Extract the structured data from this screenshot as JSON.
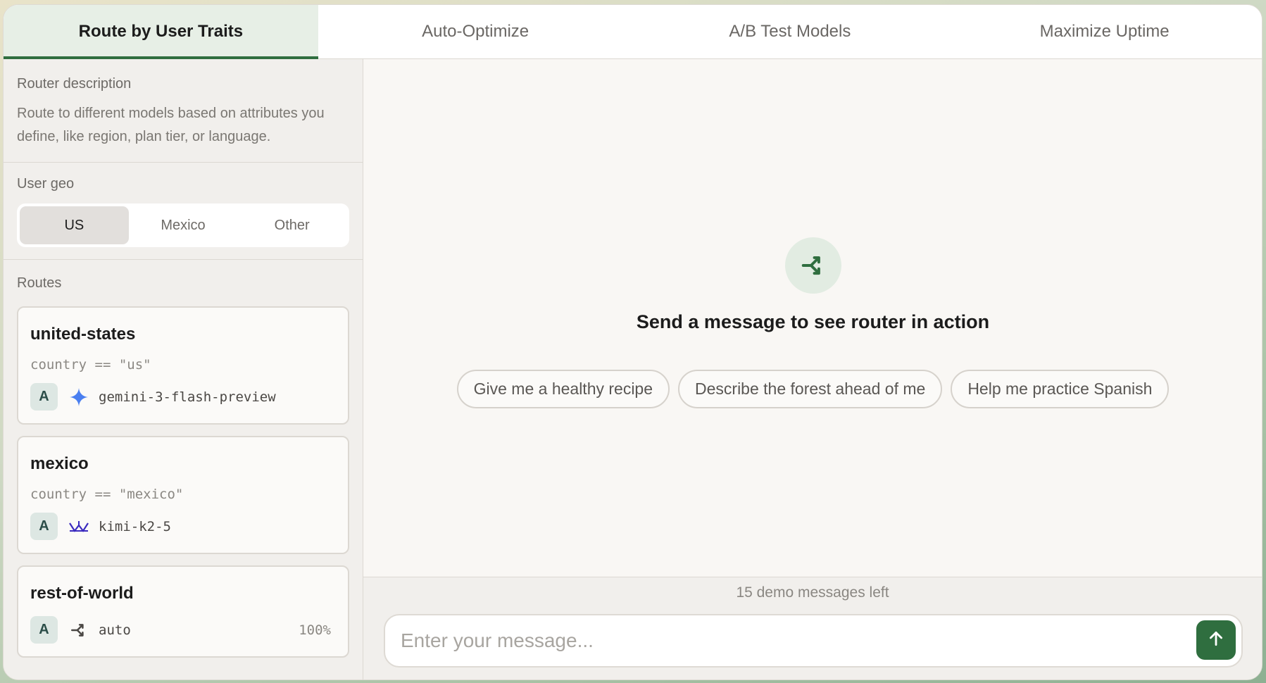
{
  "tabs": [
    {
      "label": "Route by User Traits",
      "active": true
    },
    {
      "label": "Auto-Optimize",
      "active": false
    },
    {
      "label": "A/B Test Models",
      "active": false
    },
    {
      "label": "Maximize Uptime",
      "active": false
    }
  ],
  "sidebar": {
    "description_label": "Router description",
    "description_text": "Route to different models based on attributes you define, like region, plan tier, or language.",
    "geo_label": "User geo",
    "geo_options": [
      {
        "label": "US",
        "selected": true
      },
      {
        "label": "Mexico",
        "selected": false
      },
      {
        "label": "Other",
        "selected": false
      }
    ],
    "routes_label": "Routes",
    "routes": [
      {
        "name": "united-states",
        "condition": "country == \"us\"",
        "badge": "A",
        "model_icon": "gemini-sparkle-icon",
        "model": "gemini-3-flash-preview"
      },
      {
        "name": "mexico",
        "condition": "country == \"mexico\"",
        "badge": "A",
        "model_icon": "kimi-icon",
        "model": "kimi-k2-5"
      },
      {
        "name": "rest-of-world",
        "badge": "A",
        "model_icon": "router-icon",
        "model": "auto",
        "percent": "100%"
      }
    ]
  },
  "main": {
    "empty_icon": "router-icon",
    "empty_title": "Send a message to see router in action",
    "suggestions": [
      "Give me a healthy recipe",
      "Describe the forest ahead of me",
      "Help me practice Spanish"
    ],
    "remaining": "15 demo messages left",
    "input_placeholder": "Enter your message...",
    "send_icon": "arrow-up-icon"
  },
  "colors": {
    "accent": "#2f6e3f",
    "tab_active_bg": "#e7efe6",
    "gemini": "#4a7ff0",
    "kimi": "#3b2bbf"
  }
}
